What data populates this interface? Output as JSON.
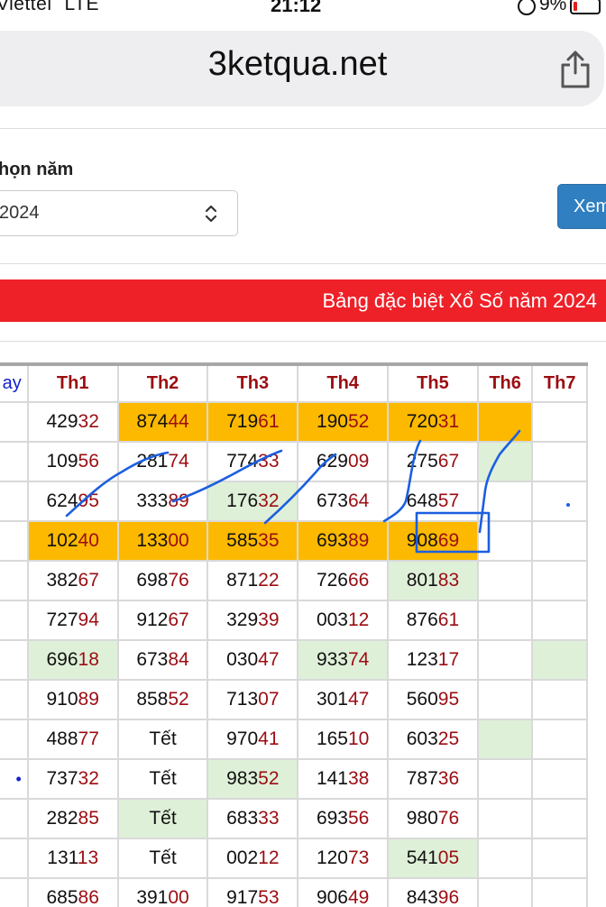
{
  "status_bar": {
    "carrier": "Viettel",
    "network": "LTE",
    "time": "21:12",
    "battery": "9%"
  },
  "browser": {
    "url": "3ketqua.net",
    "icons": {
      "share": "share-icon"
    }
  },
  "form": {
    "year_label": "họn năm",
    "year_value": "2024",
    "view_button": "Xem"
  },
  "banner": {
    "text": "Bảng đặc biệt Xổ Số năm 2024",
    "color": "#ee2128"
  },
  "table": {
    "first_header": "ay",
    "headers": [
      "Th1",
      "Th2",
      "Th3",
      "Th4",
      "Th5",
      "Th6",
      "Th7"
    ],
    "first_column_marks": [
      "",
      "",
      "",
      "",
      "",
      "",
      "",
      "",
      "",
      "•",
      "",
      "",
      ""
    ],
    "rows": [
      [
        {
          "v": "42932",
          "hl": ""
        },
        {
          "v": "87444",
          "hl": "orange"
        },
        {
          "v": "71961",
          "hl": "orange"
        },
        {
          "v": "19052",
          "hl": "orange"
        },
        {
          "v": "72031",
          "hl": "orange"
        },
        {
          "v": "",
          "hl": "orange"
        },
        {
          "v": "",
          "hl": ""
        }
      ],
      [
        {
          "v": "10956",
          "hl": ""
        },
        {
          "v": "28174",
          "hl": ""
        },
        {
          "v": "77433",
          "hl": ""
        },
        {
          "v": "62909",
          "hl": ""
        },
        {
          "v": "27567",
          "hl": ""
        },
        {
          "v": "",
          "hl": "green"
        },
        {
          "v": "",
          "hl": ""
        }
      ],
      [
        {
          "v": "62495",
          "hl": ""
        },
        {
          "v": "33389",
          "hl": ""
        },
        {
          "v": "17632",
          "hl": "green"
        },
        {
          "v": "67364",
          "hl": ""
        },
        {
          "v": "64857",
          "hl": ""
        },
        {
          "v": "",
          "hl": ""
        },
        {
          "v": "",
          "hl": ""
        }
      ],
      [
        {
          "v": "10240",
          "hl": "orange"
        },
        {
          "v": "13300",
          "hl": "orange"
        },
        {
          "v": "58535",
          "hl": "orange"
        },
        {
          "v": "69389",
          "hl": "orange"
        },
        {
          "v": "90869",
          "hl": "orange"
        },
        {
          "v": "",
          "hl": ""
        },
        {
          "v": "",
          "hl": ""
        }
      ],
      [
        {
          "v": "38267",
          "hl": ""
        },
        {
          "v": "69876",
          "hl": ""
        },
        {
          "v": "87122",
          "hl": ""
        },
        {
          "v": "72666",
          "hl": ""
        },
        {
          "v": "80183",
          "hl": "green"
        },
        {
          "v": "",
          "hl": ""
        },
        {
          "v": "",
          "hl": ""
        }
      ],
      [
        {
          "v": "72794",
          "hl": ""
        },
        {
          "v": "91267",
          "hl": ""
        },
        {
          "v": "32939",
          "hl": ""
        },
        {
          "v": "00312",
          "hl": ""
        },
        {
          "v": "87661",
          "hl": ""
        },
        {
          "v": "",
          "hl": ""
        },
        {
          "v": "",
          "hl": ""
        }
      ],
      [
        {
          "v": "69618",
          "hl": "green"
        },
        {
          "v": "67384",
          "hl": ""
        },
        {
          "v": "03047",
          "hl": ""
        },
        {
          "v": "93374",
          "hl": "green"
        },
        {
          "v": "12317",
          "hl": ""
        },
        {
          "v": "",
          "hl": ""
        },
        {
          "v": "",
          "hl": "green"
        }
      ],
      [
        {
          "v": "91089",
          "hl": ""
        },
        {
          "v": "85852",
          "hl": ""
        },
        {
          "v": "71307",
          "hl": ""
        },
        {
          "v": "30147",
          "hl": ""
        },
        {
          "v": "56095",
          "hl": ""
        },
        {
          "v": "",
          "hl": ""
        },
        {
          "v": "",
          "hl": ""
        }
      ],
      [
        {
          "v": "48877",
          "hl": ""
        },
        {
          "v": "Tết",
          "hl": ""
        },
        {
          "v": "97041",
          "hl": ""
        },
        {
          "v": "16510",
          "hl": ""
        },
        {
          "v": "60325",
          "hl": ""
        },
        {
          "v": "",
          "hl": "green"
        },
        {
          "v": "",
          "hl": ""
        }
      ],
      [
        {
          "v": "73732",
          "hl": ""
        },
        {
          "v": "Tết",
          "hl": ""
        },
        {
          "v": "98352",
          "hl": "green"
        },
        {
          "v": "14138",
          "hl": ""
        },
        {
          "v": "78736",
          "hl": ""
        },
        {
          "v": "",
          "hl": ""
        },
        {
          "v": "",
          "hl": ""
        }
      ],
      [
        {
          "v": "28285",
          "hl": ""
        },
        {
          "v": "Tết",
          "hl": "green"
        },
        {
          "v": "68333",
          "hl": ""
        },
        {
          "v": "69356",
          "hl": ""
        },
        {
          "v": "98076",
          "hl": ""
        },
        {
          "v": "",
          "hl": ""
        },
        {
          "v": "",
          "hl": ""
        }
      ],
      [
        {
          "v": "13113",
          "hl": ""
        },
        {
          "v": "Tết",
          "hl": ""
        },
        {
          "v": "00212",
          "hl": ""
        },
        {
          "v": "12073",
          "hl": ""
        },
        {
          "v": "54105",
          "hl": "green"
        },
        {
          "v": "",
          "hl": ""
        },
        {
          "v": "",
          "hl": ""
        }
      ],
      [
        {
          "v": "68586",
          "hl": ""
        },
        {
          "v": "39100",
          "hl": ""
        },
        {
          "v": "91753",
          "hl": ""
        },
        {
          "v": "90649",
          "hl": ""
        },
        {
          "v": "84396",
          "hl": ""
        },
        {
          "v": "",
          "hl": ""
        },
        {
          "v": "",
          "hl": ""
        }
      ]
    ]
  },
  "colors": {
    "highlight_orange": "#fcb900",
    "highlight_green": "#dff0d8",
    "number_tail": "#9b0d12",
    "button_blue": "#2f7fc1",
    "ink_blue": "#1c5fe0"
  }
}
